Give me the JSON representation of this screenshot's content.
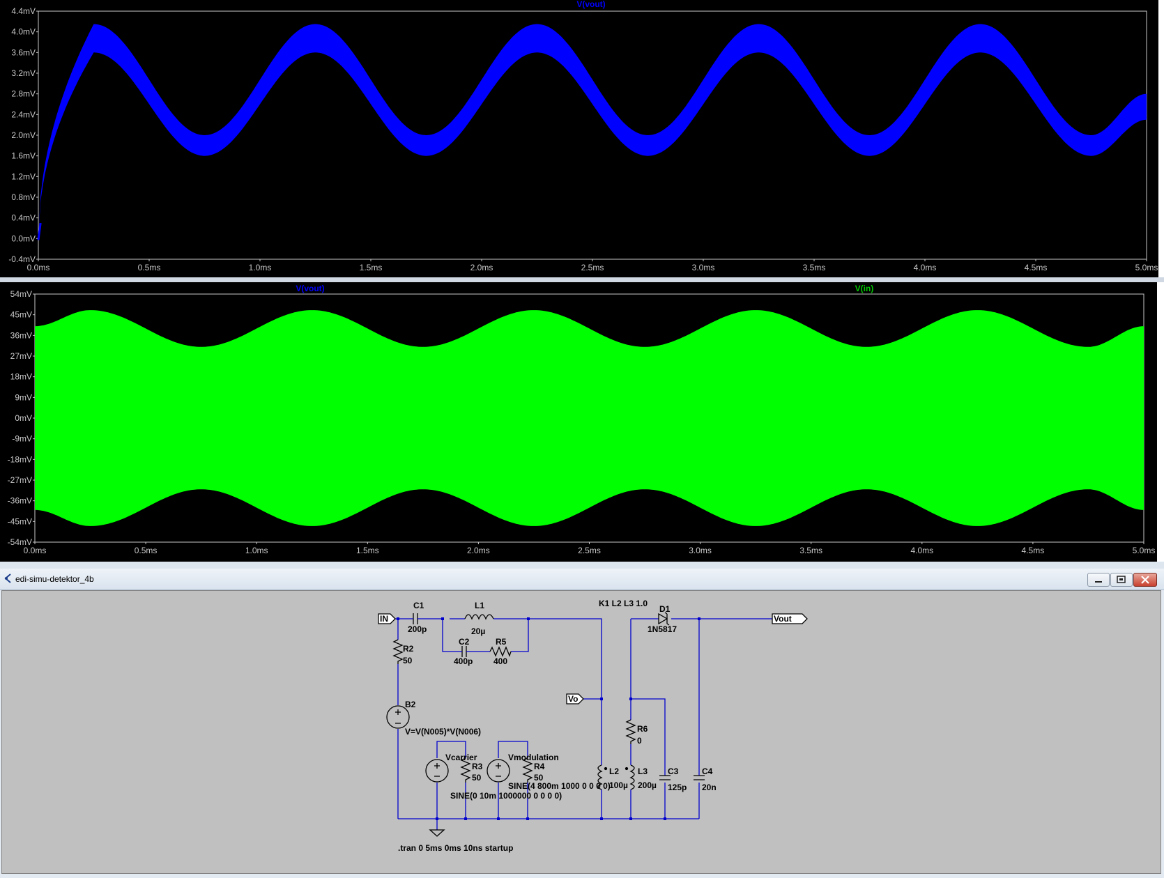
{
  "pane1": {
    "trace_label": "V(vout)",
    "trace_color": "#0000ff",
    "y_ticks": [
      "4.4mV",
      "4.0mV",
      "3.6mV",
      "3.2mV",
      "2.8mV",
      "2.4mV",
      "2.0mV",
      "1.6mV",
      "1.2mV",
      "0.8mV",
      "0.4mV",
      "0.0mV",
      "-0.4mV"
    ],
    "x_ticks": [
      "0.0ms",
      "0.5ms",
      "1.0ms",
      "1.5ms",
      "2.0ms",
      "2.5ms",
      "3.0ms",
      "3.5ms",
      "4.0ms",
      "4.5ms",
      "5.0ms"
    ]
  },
  "pane2": {
    "trace_labels": [
      "V(vout)",
      "V(in)"
    ],
    "trace_colors": [
      "#0000ff",
      "#00ff00"
    ],
    "y_ticks": [
      "54mV",
      "45mV",
      "36mV",
      "27mV",
      "18mV",
      "9mV",
      "0mV",
      "-9mV",
      "-18mV",
      "-27mV",
      "-36mV",
      "-45mV",
      "-54mV"
    ],
    "x_ticks": [
      "0.0ms",
      "0.5ms",
      "1.0ms",
      "1.5ms",
      "2.0ms",
      "2.5ms",
      "3.0ms",
      "3.5ms",
      "4.0ms",
      "4.5ms",
      "5.0ms"
    ]
  },
  "chart_data": [
    {
      "type": "area",
      "series": [
        {
          "name": "V(vout)",
          "x_ms": [
            0.0,
            0.25,
            0.75,
            1.25,
            1.75,
            2.25,
            2.75,
            3.25,
            3.75,
            4.25,
            4.75,
            5.0
          ],
          "upper_mV": [
            0.0,
            4.15,
            2.0,
            4.15,
            2.0,
            4.15,
            2.0,
            4.15,
            2.0,
            4.15,
            2.0,
            2.8
          ],
          "lower_mV": [
            0.0,
            3.6,
            1.6,
            3.6,
            1.6,
            3.6,
            1.6,
            3.6,
            1.6,
            3.6,
            1.6,
            2.3
          ]
        }
      ],
      "xlim_ms": [
        0,
        5
      ],
      "ylim_mV": [
        -0.4,
        4.4
      ]
    },
    {
      "type": "area",
      "series": [
        {
          "name": "V(in)",
          "x_ms": [
            0.0,
            0.25,
            0.75,
            1.25,
            1.75,
            2.25,
            2.75,
            3.25,
            3.75,
            4.25,
            4.75,
            5.0
          ],
          "envelope_mV": [
            40,
            47,
            31,
            47,
            31,
            47,
            31,
            47,
            31,
            47,
            31,
            40
          ]
        }
      ],
      "xlim_ms": [
        0,
        5
      ],
      "ylim_mV": [
        -54,
        54
      ]
    }
  ],
  "window": {
    "title": "edi-simu-detektor_4b"
  },
  "schematic": {
    "wire_color": "#0000cc",
    "labels": {
      "in_port": "IN",
      "vout_port": "Vout",
      "vo_port": "Vo",
      "c1": "C1",
      "c1_val": "200p",
      "l1": "L1",
      "l1_val": "20µ",
      "c2": "C2",
      "c2_val": "400p",
      "r5": "R5",
      "r5_val": "400",
      "r2": "R2",
      "r2_val": "50",
      "b2": "B2",
      "b2_val": "V=V(N005)*V(N006)",
      "vcarrier": "Vcarrier",
      "r3": "R3",
      "r3_val": "50",
      "vcarrier_val": "SINE(0 10m 1000000 0 0 0 0)",
      "vmodulation": "Vmodulation",
      "r4": "R4",
      "r4_val": "50",
      "vmod_val": "SINE(4 800m 1000 0 0 0 0)",
      "k1": "K1 L2 L3 1.0",
      "d1": "D1",
      "d1_val": "1N5817",
      "r6": "R6",
      "r6_val": "0",
      "l2": "L2",
      "l2_val": "100µ",
      "l3": "L3",
      "l3_val": "200µ",
      "c3": "C3",
      "c3_val": "125p",
      "c4": "C4",
      "c4_val": "20n",
      "tran": ".tran 0 5ms 0ms 10ns startup"
    }
  }
}
